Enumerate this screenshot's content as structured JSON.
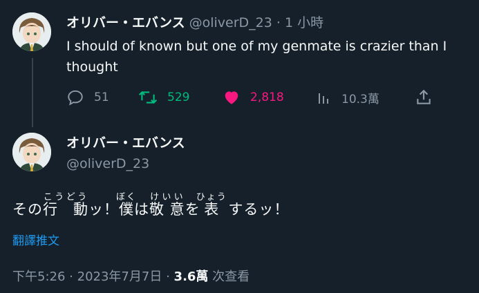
{
  "tweet1": {
    "display_name": "オリバー・エバンス",
    "handle": "@oliverD_23",
    "separator": "·",
    "time_ago": "1 小時",
    "text": "I should of known but one of my genmate is crazier than I thought",
    "actions": {
      "replies": "51",
      "retweets": "529",
      "likes": "2,818",
      "views": "10.3萬"
    }
  },
  "tweet2": {
    "display_name": "オリバー・エバンス",
    "handle": "@oliverD_23",
    "body": {
      "seg1": "その",
      "seg2_base": "行　動",
      "seg2_ruby": "こうどう",
      "seg3": "ッ！",
      "seg4_base": "僕",
      "seg4_ruby": "ぼく",
      "seg5": "は",
      "seg6_base": "敬 意",
      "seg6_ruby": "けいい",
      "seg7": "を",
      "seg8_base": "表",
      "seg8_ruby": "ひょう",
      "seg9": " するッ！"
    },
    "translate_label": "翻譯推文",
    "meta": {
      "time": "下午5:26",
      "sep1": "·",
      "date": "2023年7月7日",
      "sep2": "·",
      "views_count": "3.6萬",
      "views_label": "次查看"
    }
  },
  "colors": {
    "background": "#15202b",
    "text": "#f7f9f9",
    "muted": "#8b98a5",
    "retweet": "#00ba7c",
    "like": "#f91880",
    "link": "#1d9bf0"
  },
  "icons": [
    "avatar",
    "reply-icon",
    "retweet-icon",
    "like-heart-icon",
    "views-chart-icon",
    "share-icon"
  ]
}
